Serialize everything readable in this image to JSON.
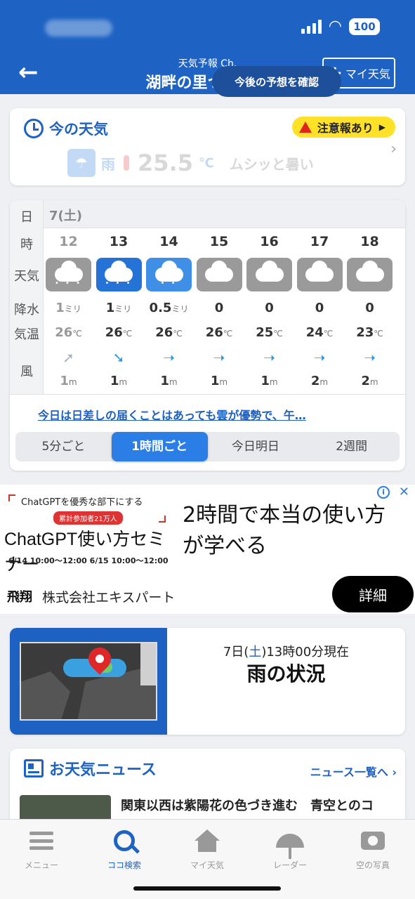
{
  "header": {
    "subtitle": "天気予報 Ch.",
    "title": "湖畔の里つきがせ",
    "back_icon": "back-arrow-icon",
    "my_weather_label": "マイ天気",
    "battery": "100",
    "color": "#1e63c4"
  },
  "now": {
    "title": "今の天気",
    "alert": "注意報あり",
    "condition": "雨",
    "temp": "25.5",
    "unit": "℃",
    "feel": "ムシッと暑い"
  },
  "hourly": {
    "labels": [
      "日",
      "時",
      "天気",
      "降水",
      "気温",
      "風"
    ],
    "date": "7(土)",
    "hours": [
      {
        "hour": "12",
        "weather": "rain-icon",
        "precip": "1",
        "precip_unit": "ミリ",
        "temp": "26",
        "temp_unit": "℃",
        "wind_dir": "➚",
        "wind": "1",
        "wind_unit": "m",
        "past": true,
        "style": "grey-rain"
      },
      {
        "hour": "13",
        "weather": "rain-icon",
        "precip": "1",
        "precip_unit": "ミリ",
        "temp": "26",
        "temp_unit": "℃",
        "wind_dir": "➘",
        "wind": "1",
        "wind_unit": "m",
        "past": false,
        "style": "rain"
      },
      {
        "hour": "14",
        "weather": "drizzle-icon",
        "precip": "0.5",
        "precip_unit": "ミリ",
        "temp": "26",
        "temp_unit": "℃",
        "wind_dir": "➝",
        "wind": "1",
        "wind_unit": "m",
        "past": false,
        "style": "drizzle"
      },
      {
        "hour": "15",
        "weather": "cloud-icon",
        "precip": "0",
        "precip_unit": "",
        "temp": "26",
        "temp_unit": "℃",
        "wind_dir": "➝",
        "wind": "1",
        "wind_unit": "m",
        "past": false,
        "style": "cloud"
      },
      {
        "hour": "16",
        "weather": "cloud-icon",
        "precip": "0",
        "precip_unit": "",
        "temp": "25",
        "temp_unit": "℃",
        "wind_dir": "➝",
        "wind": "1",
        "wind_unit": "m",
        "past": false,
        "style": "cloud"
      },
      {
        "hour": "17",
        "weather": "cloud-icon",
        "precip": "0",
        "precip_unit": "",
        "temp": "24",
        "temp_unit": "℃",
        "wind_dir": "➝",
        "wind": "2",
        "wind_unit": "m",
        "past": false,
        "style": "cloud"
      },
      {
        "hour": "18",
        "weather": "cloud-icon",
        "precip": "0",
        "precip_unit": "",
        "temp": "23",
        "temp_unit": "℃",
        "wind_dir": "➝",
        "wind": "2",
        "wind_unit": "m",
        "past": false,
        "style": "cloud"
      }
    ],
    "summary": "今日は日差しの届くことはあっても雲が優勢で、午…",
    "segments": [
      "5分ごと",
      "1時間ごと",
      "今日明日",
      "2週間"
    ],
    "active_segment": 1
  },
  "ad": {
    "pre": "ChatGPTを優秀な部下にする",
    "count": "累計参加者21万人",
    "big": "ChatGPT使い方セミナー",
    "dates": "6/14 10:00〜12:00  6/15 10:00〜12:00",
    "headline": "2時間で本当の使い方が学べる",
    "logo": "飛翔",
    "company": "株式会社エキスパート",
    "detail_label": "詳細"
  },
  "rain": {
    "time_pre": "7日(",
    "time_day": "土",
    "time_post": ")13時00分現在",
    "headline": "雨の状況",
    "button": "今後の予想を確認"
  },
  "news": {
    "title": "お天気ニュース",
    "more": "ニュース一覧へ",
    "headline": "関東以西は紫陽花の色づき進む　青空とのコ"
  },
  "tabbar": {
    "items": [
      {
        "label": "メニュー",
        "icon": "menu-icon"
      },
      {
        "label": "ココ検索",
        "icon": "search-icon"
      },
      {
        "label": "マイ天気",
        "icon": "home-icon"
      },
      {
        "label": "レーダー",
        "icon": "umbrella-icon"
      },
      {
        "label": "空の写真",
        "icon": "camera-icon"
      }
    ],
    "active": 1
  }
}
